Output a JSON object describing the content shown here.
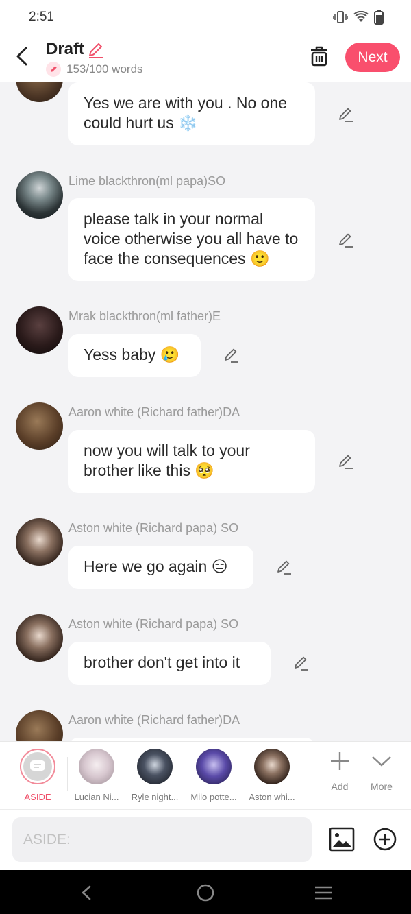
{
  "status": {
    "time": "2:51"
  },
  "header": {
    "title": "Draft",
    "word_count": "153/100 words",
    "next_label": "Next"
  },
  "messages": [
    {
      "name": "",
      "text": "Yes we are with you . No one could hurt us ❄️"
    },
    {
      "name": "Lime blackthron(ml papa)SO",
      "text": "please talk in your normal voice otherwise you all have to face the consequences 🙂"
    },
    {
      "name": "Mrak blackthron(ml father)E",
      "text": "Yess baby 🥲"
    },
    {
      "name": "Aaron white (Richard father)DA",
      "text": "now you will talk to your brother like this 🥺"
    },
    {
      "name": "Aston white (Richard papa) SO",
      "text": "Here we go again 😑"
    },
    {
      "name": "Aston white (Richard papa) SO",
      "text": "brother don't get into it"
    },
    {
      "name": "Aaron white (Richard father)DA",
      "text": ""
    }
  ],
  "characters": [
    {
      "label": "ASIDE"
    },
    {
      "label": "Lucian Ni..."
    },
    {
      "label": "Ryle night..."
    },
    {
      "label": "Milo potte..."
    },
    {
      "label": "Aston whi..."
    }
  ],
  "tools": {
    "add_label": "Add",
    "more_label": "More"
  },
  "input": {
    "placeholder": "ASIDE:"
  },
  "colors": {
    "accent": "#f94f6d",
    "background": "#f3f3f5"
  }
}
